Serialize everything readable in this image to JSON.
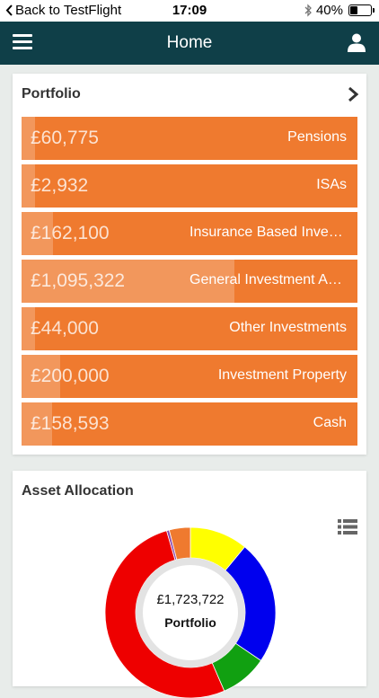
{
  "status_bar": {
    "back_label": "Back to TestFlight",
    "time": "17:09",
    "battery": "40%",
    "battery_level": 0.4
  },
  "nav": {
    "title": "Home",
    "menu_icon": "hamburger-menu-icon",
    "user_icon": "user-icon",
    "background": "#0f3f48"
  },
  "portfolio": {
    "title": "Portfolio",
    "row_color": "#ef7a2f",
    "rows": [
      {
        "amount": "£60,775",
        "name": "Pensions",
        "share": 0.035
      },
      {
        "amount": "£2,932",
        "name": "ISAs",
        "share": 0.002
      },
      {
        "amount": "£162,100",
        "name": "Insurance Based Investments",
        "share": 0.094
      },
      {
        "amount": "£1,095,322",
        "name": "General Investment Account",
        "share": 0.635
      },
      {
        "amount": "£44,000",
        "name": "Other Investments",
        "share": 0.026
      },
      {
        "amount": "£200,000",
        "name": "Investment Property",
        "share": 0.116
      },
      {
        "amount": "£158,593",
        "name": "Cash",
        "share": 0.092
      }
    ]
  },
  "asset_allocation": {
    "title": "Asset Allocation",
    "total": "£1,723,722",
    "center_label": "Portfolio",
    "segments": [
      {
        "color": "#ffff00",
        "fraction": 0.11
      },
      {
        "color": "#0000ee",
        "fraction": 0.235
      },
      {
        "color": "#11a011",
        "fraction": 0.09
      },
      {
        "color": "#ee0000",
        "fraction": 0.52
      },
      {
        "color": "#8844aa",
        "fraction": 0.005
      },
      {
        "color": "#ef7a2f",
        "fraction": 0.04
      }
    ]
  }
}
